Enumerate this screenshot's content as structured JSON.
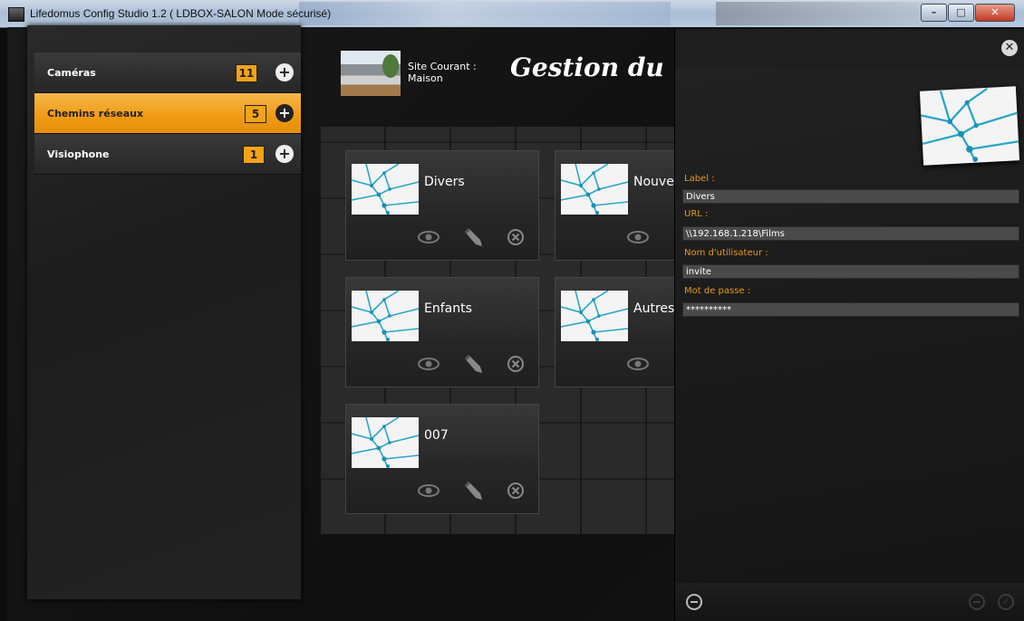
{
  "window": {
    "title": "Lifedomus Config Studio 1.2 ( LDBOX-SALON Mode sécurisé)"
  },
  "sidebar": {
    "items": [
      {
        "label": "Caméras",
        "count": "11",
        "active": false
      },
      {
        "label": "Chemins réseaux",
        "count": "5",
        "active": true
      },
      {
        "label": "Visiophone",
        "count": "1",
        "active": false
      }
    ]
  },
  "header": {
    "site_label": "Site Courant :",
    "site_name": "Maison",
    "page_title": "Gestion du multimédia"
  },
  "cards": [
    {
      "name": "Divers"
    },
    {
      "name": "Nouveau"
    },
    {
      "name": "Enfants"
    },
    {
      "name": "Autres"
    },
    {
      "name": "007"
    }
  ],
  "panel": {
    "fields": [
      {
        "label": "Label :",
        "value": "Divers"
      },
      {
        "label": "URL :",
        "value": "\\\\192.168.1.218\\Films"
      },
      {
        "label": "Nom d'utilisateur :",
        "value": "invite"
      },
      {
        "label": "Mot de passe :",
        "value": "**********"
      }
    ],
    "ghost_count": "11"
  },
  "colors": {
    "accent": "#f09a12",
    "field_label": "#e79a1a"
  },
  "icons": [
    "close-icon",
    "plus-icon",
    "eye-icon",
    "pencil-icon",
    "delete-icon",
    "minus-circle-icon",
    "check-circle-icon",
    "network-thumbnail-icon"
  ]
}
